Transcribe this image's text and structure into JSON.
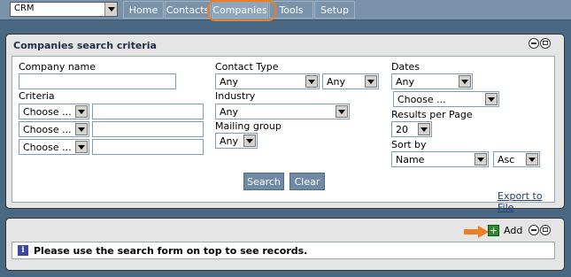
{
  "nav": {
    "module_value": "CRM",
    "tabs": [
      {
        "label": "Home"
      },
      {
        "label": "Contacts"
      },
      {
        "label": "Companies"
      },
      {
        "label": "Tools"
      },
      {
        "label": "Setup"
      }
    ],
    "active_tab": "Companies"
  },
  "search_panel": {
    "title": "Companies search criteria",
    "company_name_label": "Company name",
    "company_name_value": "",
    "criteria_label": "Criteria",
    "criteria_rows": [
      {
        "select": "Choose ...",
        "value": ""
      },
      {
        "select": "Choose ...",
        "value": ""
      },
      {
        "select": "Choose ...",
        "value": ""
      }
    ],
    "contact_type_label": "Contact Type",
    "contact_type_value": "Any",
    "contact_type_value2": "Any",
    "industry_label": "Industry",
    "industry_value": "Any",
    "mailing_group_label": "Mailing group",
    "mailing_group_value": "Any",
    "dates_label": "Dates",
    "dates_value": "Any",
    "dates_choose_value": "Choose ...",
    "results_per_page_label": "Results per Page",
    "results_per_page_value": "20",
    "sort_by_label": "Sort by",
    "sort_by_value": "Name",
    "sort_order_value": "Asc",
    "search_button": "Search",
    "clear_button": "Clear",
    "export_link": "Export to File"
  },
  "results_panel": {
    "add_label": "Add",
    "message": "Please use the search form on top to see records.",
    "info_icon_glyph": "i"
  },
  "colors": {
    "highlight": "#ef7d23",
    "nav_bg": "#7a93ab",
    "page_bg": "#4a6882"
  }
}
